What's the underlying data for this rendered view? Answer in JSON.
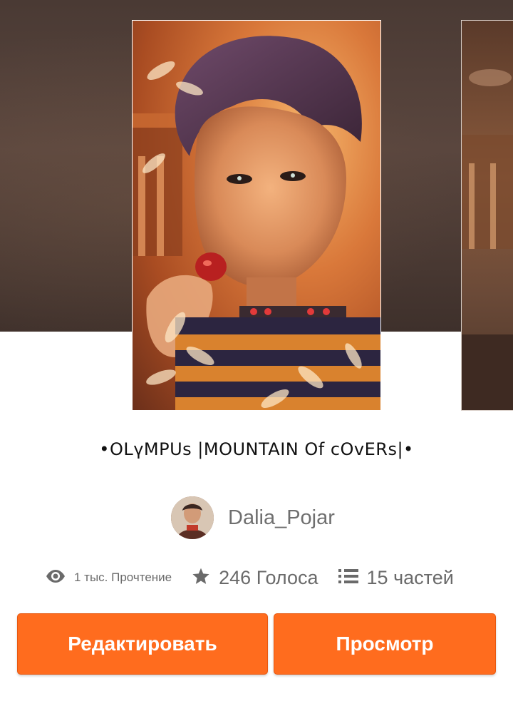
{
  "book": {
    "title": "•OLүMPUs |MOUNTAIN Of cOvERs|•",
    "cover_image": "portrait-illustration-cover",
    "next_cover_image": "partial-next-cover"
  },
  "author": {
    "name": "Dalia_Pojar",
    "avatar": "author-avatar"
  },
  "stats": {
    "reads_icon": "eye-icon",
    "reads": "1 тыс. Прочтение",
    "votes_icon": "star-icon",
    "votes": "246 Голоса",
    "parts_icon": "list-icon",
    "parts": "15 частей"
  },
  "actions": {
    "edit_label": "Редактировать",
    "view_label": "Просмотр"
  },
  "colors": {
    "accent": "#ff6c1e",
    "hero_bg": "#4a3a34",
    "stat_text": "#6a6a6a",
    "author_text": "#6f6f6f"
  }
}
